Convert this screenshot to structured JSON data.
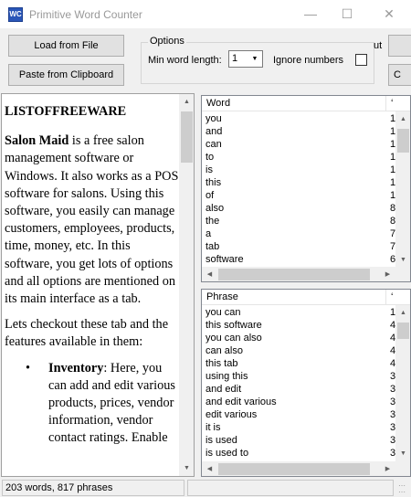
{
  "window": {
    "title": "Primitive Word Counter",
    "icon_text": "WC",
    "icon": "app-icon"
  },
  "toolbar": {
    "load_label": "Load from File",
    "paste_label": "Paste from Clipboard",
    "right1_label": "",
    "right2_label": "C"
  },
  "options": {
    "legend": "Options",
    "min_word_length_label": "Min word length:",
    "min_word_length_value": "1",
    "ignore_numbers_label": "Ignore numbers",
    "ignore_numbers_checked": false,
    "trailing_text": "ut"
  },
  "document": {
    "heading": "LISTOFFREEWARE",
    "p1_bold": "Salon Maid",
    "p1_rest": " is a free salon management software or Windows. It also works as a POS software for salons. Using this software, you easily can manage customers, employees, products, time, money, etc. In this software, you get lots of options and all options are mentioned on its main interface as a tab.",
    "p2": "Lets checkout these tab and the features available in them:",
    "li1_bullet": "•",
    "li1_bold": "Inventory",
    "li1_rest": ": Here, you can add and edit various products, prices, vendor information, vendor contact ratings. Enable"
  },
  "word_list": {
    "header_col1": "Word",
    "header_col2": "‘",
    "rows": [
      {
        "word": "you",
        "count": "1"
      },
      {
        "word": "and",
        "count": "1"
      },
      {
        "word": "can",
        "count": "1"
      },
      {
        "word": "to",
        "count": "1"
      },
      {
        "word": "is",
        "count": "1"
      },
      {
        "word": "this",
        "count": "1"
      },
      {
        "word": "of",
        "count": "1"
      },
      {
        "word": "also",
        "count": "8"
      },
      {
        "word": "the",
        "count": "8"
      },
      {
        "word": "a",
        "count": "7"
      },
      {
        "word": "tab",
        "count": "7"
      },
      {
        "word": "software",
        "count": "6"
      }
    ]
  },
  "phrase_list": {
    "header_col1": "Phrase",
    "header_col2": "‘",
    "rows": [
      {
        "phrase": "you can",
        "count": "1"
      },
      {
        "phrase": "this software",
        "count": "4"
      },
      {
        "phrase": "you can also",
        "count": "4"
      },
      {
        "phrase": "can also",
        "count": "4"
      },
      {
        "phrase": "this tab",
        "count": "4"
      },
      {
        "phrase": "using this",
        "count": "3"
      },
      {
        "phrase": "and edit",
        "count": "3"
      },
      {
        "phrase": "and edit various",
        "count": "3"
      },
      {
        "phrase": "edit various",
        "count": "3"
      },
      {
        "phrase": "it is",
        "count": "3"
      },
      {
        "phrase": "is used",
        "count": "3"
      },
      {
        "phrase": "is used to",
        "count": "3"
      }
    ]
  },
  "status": {
    "summary": "203 words, 817 phrases",
    "secondary": ""
  },
  "colors": {
    "window_bg": "#f0f0f0",
    "list_border": "#828790",
    "button_bg": "#e1e1e1"
  }
}
